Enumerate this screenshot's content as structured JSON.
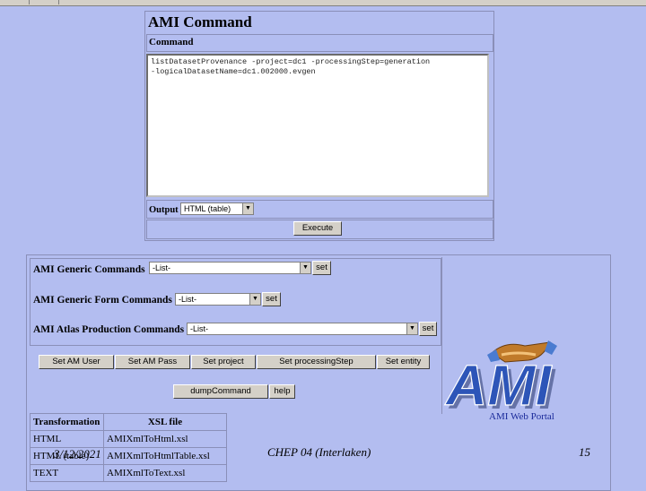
{
  "ami_command": {
    "title": "AMI Command",
    "command_label": "Command",
    "command_text": "listDatasetProvenance -project=dc1 -processingStep=generation\n-logicalDatasetName=dc1.002000.evgen",
    "output_label": "Output",
    "output_value": "HTML (table)",
    "execute_label": "Execute"
  },
  "generic": {
    "generic_commands_label": "AMI Generic Commands",
    "generic_commands_value": "-List-",
    "generic_form_label": "AMI Generic Form Commands",
    "generic_form_value": "-List-",
    "atlas_label": "AMI Atlas Production Commands",
    "atlas_value": "-List-",
    "set_label": "set"
  },
  "buttons": {
    "set_am_user": "Set AM User",
    "set_am_pass": "Set AM Pass",
    "set_project": "Set project",
    "set_processing_step": "Set processingStep",
    "set_entity": "Set entity",
    "dump_command": "dumpCommand",
    "help": "help"
  },
  "logo": {
    "text": "AMI",
    "caption": "AMI Web Portal"
  },
  "xsl_table": {
    "headers": [
      "Transformation",
      "XSL file"
    ],
    "rows": [
      [
        "HTML",
        "AMIXmlToHtml.xsl"
      ],
      [
        "HTML (table)",
        "AMIXmlToHtmlTable.xsl"
      ],
      [
        "TEXT",
        "AMIXmlToText.xsl"
      ]
    ]
  },
  "footer": {
    "date": "3/12/2021",
    "conference": "CHEP 04 (Interlaken)",
    "page": "15"
  },
  "colors": {
    "background": "#b3bdf0",
    "logo_blue": "#2d55b8"
  }
}
